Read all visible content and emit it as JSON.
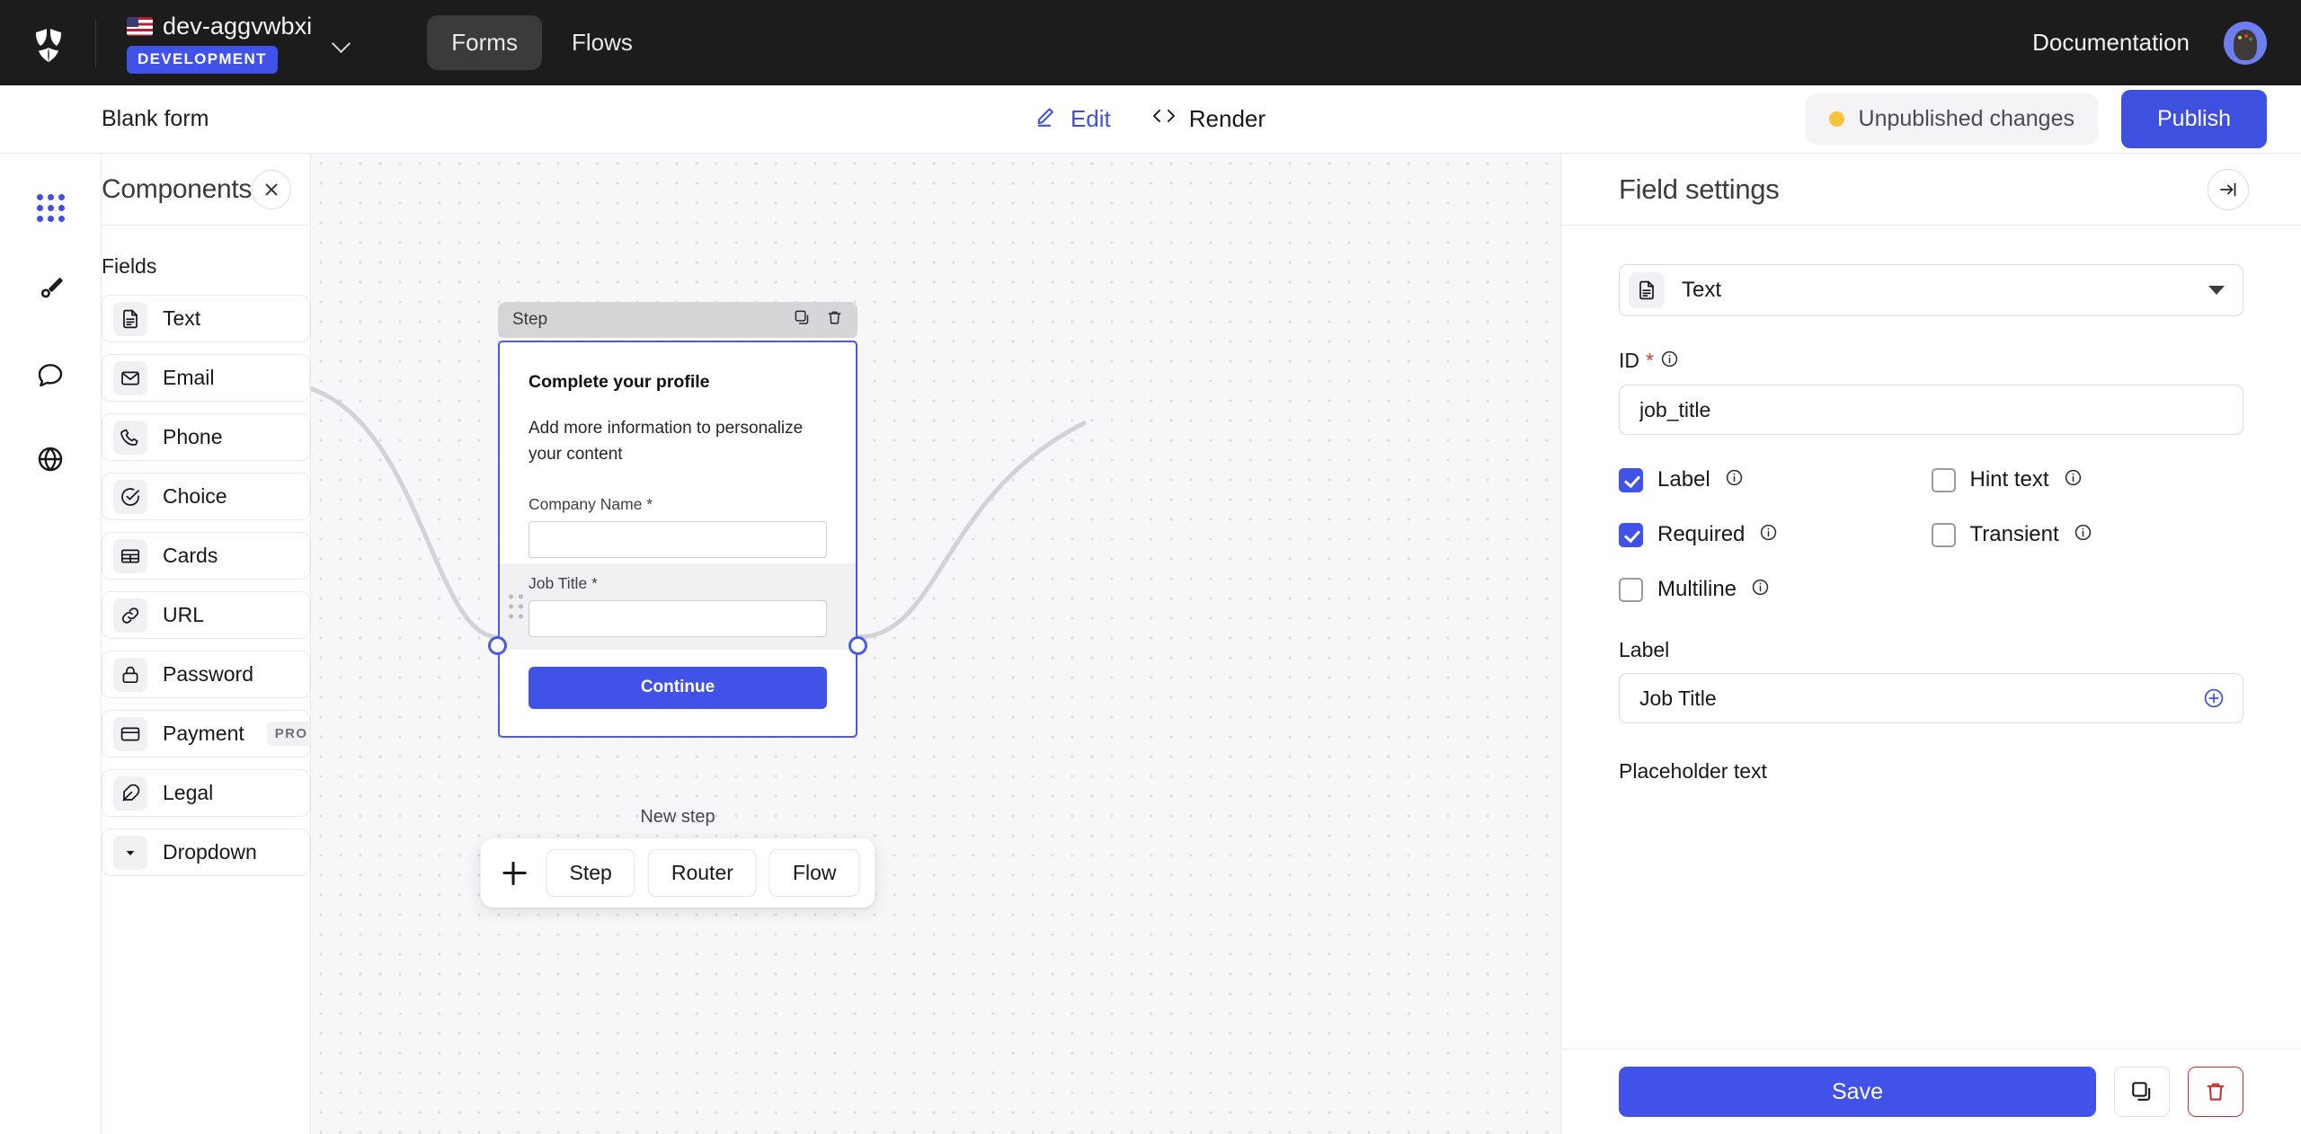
{
  "topbar": {
    "logo_icon": "shield-logo",
    "project_name": "dev-aggvwbxi",
    "project_flag": "us-flag",
    "environment_badge": "DEVELOPMENT",
    "project_chevron_icon": "chevron-down-icon",
    "tabs": [
      {
        "label": "Forms",
        "active": true
      },
      {
        "label": "Flows",
        "active": false
      }
    ],
    "documentation_label": "Documentation",
    "avatar_icon": "user-avatar"
  },
  "subbar": {
    "form_title": "Blank form",
    "edit_label": "Edit",
    "edit_icon": "pencil-icon",
    "render_label": "Render",
    "render_icon": "code-brackets-icon",
    "unpublished_label": "Unpublished changes",
    "unpublished_dot_color": "#f5c43a",
    "publish_label": "Publish",
    "accent_color": "#3d50e0"
  },
  "rail": {
    "items": [
      {
        "icon": "apps-grid-icon",
        "active": true
      },
      {
        "icon": "brush-icon",
        "active": false
      },
      {
        "icon": "chat-bubble-icon",
        "active": false
      },
      {
        "icon": "globe-icon",
        "active": false
      }
    ]
  },
  "components": {
    "title": "Components",
    "close_icon": "close-icon",
    "section_label": "Fields",
    "fields": [
      {
        "label": "Text",
        "icon": "document-text-icon",
        "badge": ""
      },
      {
        "label": "Email",
        "icon": "envelope-icon",
        "badge": ""
      },
      {
        "label": "Phone",
        "icon": "phone-icon",
        "badge": ""
      },
      {
        "label": "Choice",
        "icon": "check-circle-icon",
        "badge": ""
      },
      {
        "label": "Cards",
        "icon": "table-grid-icon",
        "badge": ""
      },
      {
        "label": "URL",
        "icon": "link-icon",
        "badge": ""
      },
      {
        "label": "Password",
        "icon": "lock-icon",
        "badge": ""
      },
      {
        "label": "Payment",
        "icon": "credit-card-icon",
        "badge": "PRO"
      },
      {
        "label": "Legal",
        "icon": "feather-icon",
        "badge": ""
      },
      {
        "label": "Dropdown",
        "icon": "caret-down-icon",
        "badge": ""
      }
    ]
  },
  "canvas": {
    "step": {
      "header_label": "Step",
      "duplicate_icon": "duplicate-icon",
      "delete_icon": "trash-icon",
      "heading": "Complete your profile",
      "description": "Add more information to personalize your content",
      "fields": [
        {
          "label": "Company Name *",
          "value": "",
          "selected": false
        },
        {
          "label": "Job Title *",
          "value": "",
          "selected": true
        }
      ],
      "submit_label": "Continue"
    },
    "new_step_label": "New step",
    "add_bar": {
      "plus_icon": "plus-icon",
      "buttons": [
        "Step",
        "Router",
        "Flow"
      ]
    }
  },
  "settings": {
    "title": "Field settings",
    "collapse_icon": "collapse-right-icon",
    "type": {
      "label": "Text",
      "icon": "document-text-icon"
    },
    "id": {
      "label": "ID",
      "required_mark": "*",
      "info_icon": "info-icon",
      "value": "job_title",
      "placeholder": ""
    },
    "checkboxes": [
      {
        "label": "Label",
        "checked": true,
        "info_icon": "info-icon"
      },
      {
        "label": "Hint text",
        "checked": false,
        "info_icon": "info-icon"
      },
      {
        "label": "Required",
        "checked": true,
        "info_icon": "info-icon"
      },
      {
        "label": "Transient",
        "checked": false,
        "info_icon": "info-icon"
      },
      {
        "label": "Multiline",
        "checked": false,
        "info_icon": "info-icon"
      }
    ],
    "label_field": {
      "label": "Label",
      "value": "Job Title",
      "placeholder": "",
      "add_icon": "plus-circle-icon"
    },
    "placeholder_field": {
      "label": "Placeholder text"
    },
    "footer": {
      "save_label": "Save",
      "duplicate_icon": "duplicate-icon",
      "delete_icon": "trash-icon"
    }
  }
}
